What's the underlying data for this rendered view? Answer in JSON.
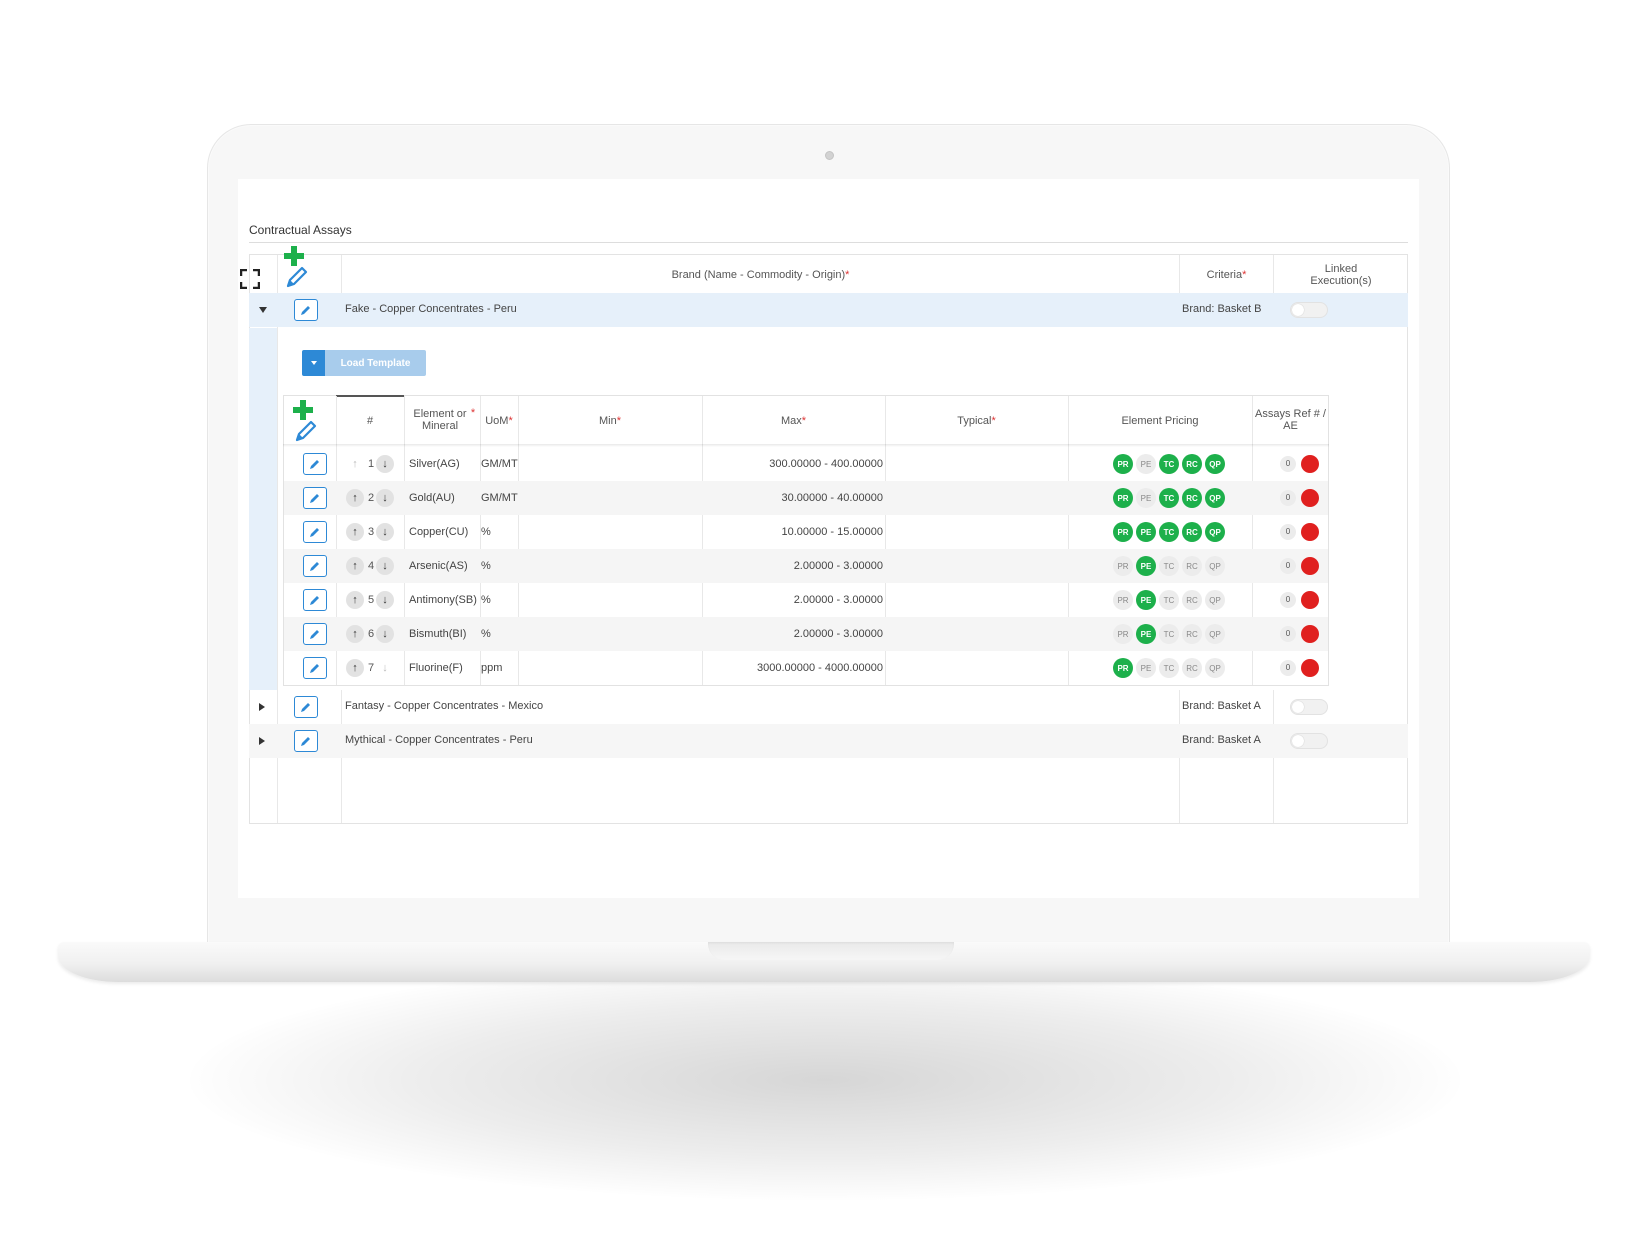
{
  "section": {
    "title": "Contractual Assays"
  },
  "master_header": {
    "brand": "Brand (Name - Commodity - Origin)",
    "criteria": "Criteria",
    "linked": [
      "Linked",
      "Execution(s)"
    ],
    "required_mark": "*"
  },
  "master_rows": [
    {
      "name": "Fake - Copper Concentrates - Peru",
      "criteria": "Brand: Basket B",
      "expanded": true,
      "linked_on": false
    },
    {
      "name": "Fantasy - Copper Concentrates - Mexico",
      "criteria": "Brand: Basket A",
      "expanded": false,
      "linked_on": false
    },
    {
      "name": "Mythical - Copper Concentrates - Peru",
      "criteria": "Brand: Basket A",
      "expanded": false,
      "linked_on": false
    }
  ],
  "template": {
    "load_label": "Load Template"
  },
  "detail_header": {
    "num": "#",
    "element": [
      "Element or",
      "Mineral"
    ],
    "uom": "UoM",
    "min": "Min",
    "max": "Max",
    "typical": "Typical",
    "pricing": "Element Pricing",
    "assays": [
      "Assays Ref # /",
      "AE"
    ]
  },
  "pricing_codes": [
    "PR",
    "PE",
    "TC",
    "RC",
    "QP"
  ],
  "elements": [
    {
      "num": "1",
      "element": "Silver(AG)",
      "uom": "GM/MT",
      "min": "",
      "max": "300.00000 - 400.00000",
      "typical": "",
      "pricing": [
        true,
        false,
        true,
        true,
        true
      ],
      "count": "0",
      "up_enabled": false,
      "down_enabled": true
    },
    {
      "num": "2",
      "element": "Gold(AU)",
      "uom": "GM/MT",
      "min": "",
      "max": "30.00000 - 40.00000",
      "typical": "",
      "pricing": [
        true,
        false,
        true,
        true,
        true
      ],
      "count": "0",
      "up_enabled": true,
      "down_enabled": true
    },
    {
      "num": "3",
      "element": "Copper(CU)",
      "uom": "%",
      "min": "",
      "max": "10.00000 - 15.00000",
      "typical": "",
      "pricing": [
        true,
        true,
        true,
        true,
        true
      ],
      "count": "0",
      "up_enabled": true,
      "down_enabled": true
    },
    {
      "num": "4",
      "element": "Arsenic(AS)",
      "uom": "%",
      "min": "",
      "max": "2.00000 - 3.00000",
      "typical": "",
      "pricing": [
        false,
        true,
        false,
        false,
        false
      ],
      "count": "0",
      "up_enabled": true,
      "down_enabled": true
    },
    {
      "num": "5",
      "element": "Antimony(SB)",
      "uom": "%",
      "min": "",
      "max": "2.00000 - 3.00000",
      "typical": "",
      "pricing": [
        false,
        true,
        false,
        false,
        false
      ],
      "count": "0",
      "up_enabled": true,
      "down_enabled": true
    },
    {
      "num": "6",
      "element": "Bismuth(BI)",
      "uom": "%",
      "min": "",
      "max": "2.00000 - 3.00000",
      "typical": "",
      "pricing": [
        false,
        true,
        false,
        false,
        false
      ],
      "count": "0",
      "up_enabled": true,
      "down_enabled": true
    },
    {
      "num": "7",
      "element": "Fluorine(F)",
      "uom": "ppm",
      "min": "",
      "max": "3000.00000 - 4000.00000",
      "typical": "",
      "pricing": [
        true,
        false,
        false,
        false,
        false
      ],
      "count": "0",
      "up_enabled": true,
      "down_enabled": false
    }
  ],
  "colors": {
    "accent": "#2d89d6",
    "active_badge": "#1db04b",
    "status_dot": "#e0201f",
    "expanded_row": "#e6f0fa"
  },
  "icons": {
    "fullscreen": "expand-icon",
    "add": "plus-icon",
    "edit": "pencil-icon",
    "up": "arrow-up-icon",
    "down": "arrow-down-icon"
  }
}
